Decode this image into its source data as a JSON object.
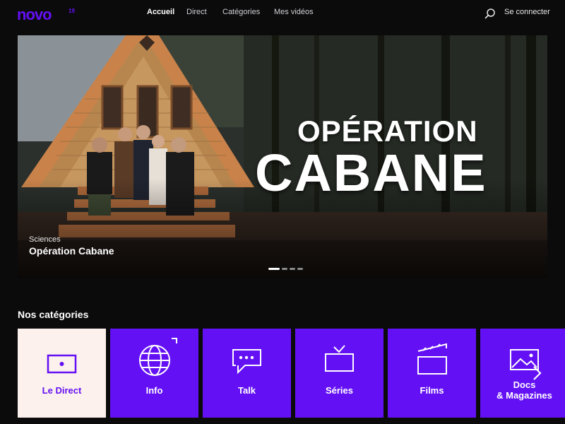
{
  "header": {
    "logo_alt": "novo 19",
    "nav": [
      {
        "label": "Accueil",
        "active": true
      },
      {
        "label": "Direct",
        "active": false
      },
      {
        "label": "Catégories",
        "active": false
      },
      {
        "label": "Mes vidéos",
        "active": false
      }
    ],
    "login_label": "Se connecter",
    "search_icon": "search-icon"
  },
  "hero": {
    "category": "Sciences",
    "title": "Opération Cabane",
    "brand_line1": "OPÉRATION",
    "brand_line2": "CABANE",
    "slide_count": 4,
    "active_slide": 0
  },
  "categories": {
    "title": "Nos catégories",
    "items": [
      {
        "label": "Le Direct",
        "icon": "tv-live-icon",
        "label2": ""
      },
      {
        "label": "Info",
        "icon": "globe-icon",
        "label2": ""
      },
      {
        "label": "Talk",
        "icon": "chat-bubble-icon",
        "label2": ""
      },
      {
        "label": "Séries",
        "icon": "tv-icon",
        "label2": ""
      },
      {
        "label": "Films",
        "icon": "clapperboard-icon",
        "label2": ""
      },
      {
        "label": "Docs",
        "icon": "image-icon",
        "label2": "& Magazines"
      }
    ],
    "next_icon": "chevron-right-icon"
  },
  "colors": {
    "accent": "#6410f5",
    "background": "#0b0b0c",
    "card_light": "#fcf1ec"
  }
}
